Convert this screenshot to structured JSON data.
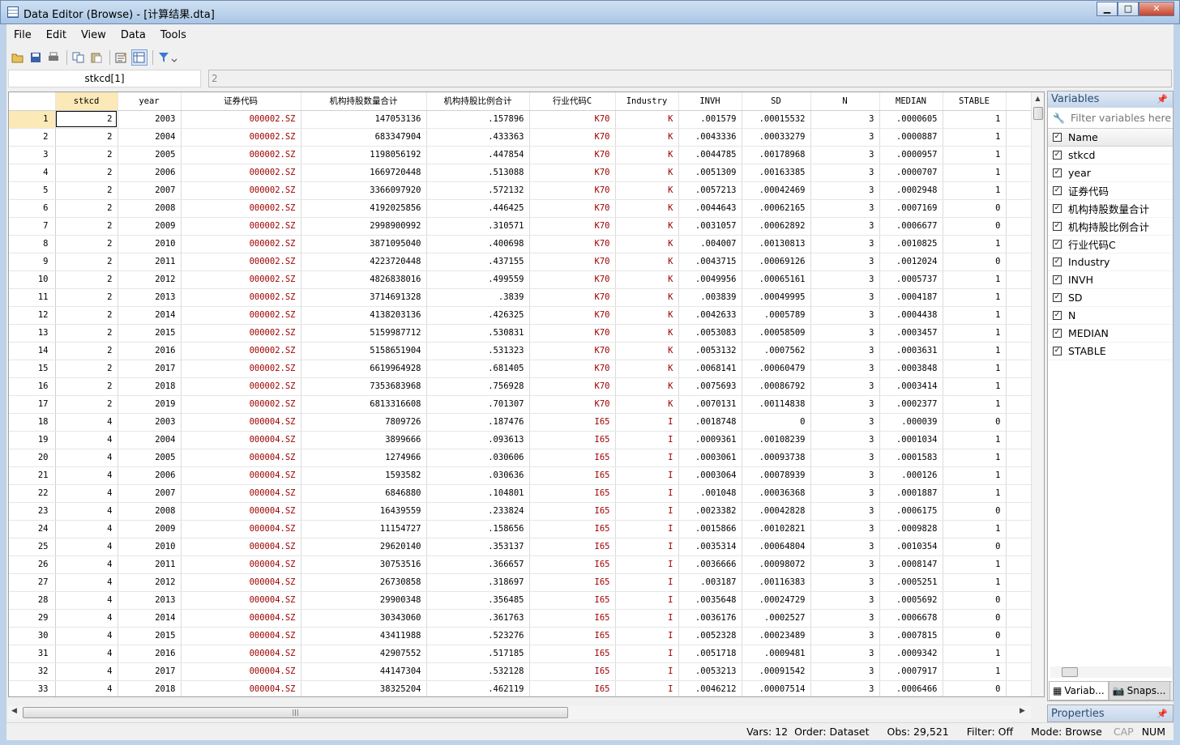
{
  "window": {
    "title": "Data Editor (Browse) - [计算结果.dta]",
    "minimize": "▁",
    "maximize": "□",
    "close": "✕"
  },
  "menu": [
    "File",
    "Edit",
    "View",
    "Data",
    "Tools"
  ],
  "toolbar_icons": [
    "open-icon",
    "save-icon",
    "print-icon",
    "copy-icon",
    "paste-icon",
    "variables-manager-icon",
    "properties-icon",
    "filter-icon"
  ],
  "cell_ref": "stkcd[1]",
  "cell_value": "2",
  "columns": [
    "stkcd",
    "year",
    "证券代码",
    "机构持股数量合计",
    "机构持股比例合计",
    "行业代码C",
    "Industry",
    "INVH",
    "SD",
    "N",
    "MEDIAN",
    "STABLE"
  ],
  "rows": [
    [
      "1",
      "2",
      "2003",
      "000002.SZ",
      "147053136",
      ".157896",
      "K70",
      "K",
      ".001579",
      ".00015532",
      "3",
      ".0000605",
      "1"
    ],
    [
      "2",
      "2",
      "2004",
      "000002.SZ",
      "683347904",
      ".433363",
      "K70",
      "K",
      ".0043336",
      ".00033279",
      "3",
      ".0000887",
      "1"
    ],
    [
      "3",
      "2",
      "2005",
      "000002.SZ",
      "1198056192",
      ".447854",
      "K70",
      "K",
      ".0044785",
      ".00178968",
      "3",
      ".0000957",
      "1"
    ],
    [
      "4",
      "2",
      "2006",
      "000002.SZ",
      "1669720448",
      ".513088",
      "K70",
      "K",
      ".0051309",
      ".00163385",
      "3",
      ".0000707",
      "1"
    ],
    [
      "5",
      "2",
      "2007",
      "000002.SZ",
      "3366097920",
      ".572132",
      "K70",
      "K",
      ".0057213",
      ".00042469",
      "3",
      ".0002948",
      "1"
    ],
    [
      "6",
      "2",
      "2008",
      "000002.SZ",
      "4192025856",
      ".446425",
      "K70",
      "K",
      ".0044643",
      ".00062165",
      "3",
      ".0007169",
      "0"
    ],
    [
      "7",
      "2",
      "2009",
      "000002.SZ",
      "2998900992",
      ".310571",
      "K70",
      "K",
      ".0031057",
      ".00062892",
      "3",
      ".0006677",
      "0"
    ],
    [
      "8",
      "2",
      "2010",
      "000002.SZ",
      "3871095040",
      ".400698",
      "K70",
      "K",
      ".004007",
      ".00130813",
      "3",
      ".0010825",
      "1"
    ],
    [
      "9",
      "2",
      "2011",
      "000002.SZ",
      "4223720448",
      ".437155",
      "K70",
      "K",
      ".0043715",
      ".00069126",
      "3",
      ".0012024",
      "0"
    ],
    [
      "10",
      "2",
      "2012",
      "000002.SZ",
      "4826838016",
      ".499559",
      "K70",
      "K",
      ".0049956",
      ".00065161",
      "3",
      ".0005737",
      "1"
    ],
    [
      "11",
      "2",
      "2013",
      "000002.SZ",
      "3714691328",
      ".3839",
      "K70",
      "K",
      ".003839",
      ".00049995",
      "3",
      ".0004187",
      "1"
    ],
    [
      "12",
      "2",
      "2014",
      "000002.SZ",
      "4138203136",
      ".426325",
      "K70",
      "K",
      ".0042633",
      ".0005789",
      "3",
      ".0004438",
      "1"
    ],
    [
      "13",
      "2",
      "2015",
      "000002.SZ",
      "5159987712",
      ".530831",
      "K70",
      "K",
      ".0053083",
      ".00058509",
      "3",
      ".0003457",
      "1"
    ],
    [
      "14",
      "2",
      "2016",
      "000002.SZ",
      "5158651904",
      ".531323",
      "K70",
      "K",
      ".0053132",
      ".0007562",
      "3",
      ".0003631",
      "1"
    ],
    [
      "15",
      "2",
      "2017",
      "000002.SZ",
      "6619964928",
      ".681405",
      "K70",
      "K",
      ".0068141",
      ".00060479",
      "3",
      ".0003848",
      "1"
    ],
    [
      "16",
      "2",
      "2018",
      "000002.SZ",
      "7353683968",
      ".756928",
      "K70",
      "K",
      ".0075693",
      ".00086792",
      "3",
      ".0003414",
      "1"
    ],
    [
      "17",
      "2",
      "2019",
      "000002.SZ",
      "6813316608",
      ".701307",
      "K70",
      "K",
      ".0070131",
      ".00114838",
      "3",
      ".0002377",
      "1"
    ],
    [
      "18",
      "4",
      "2003",
      "000004.SZ",
      "7809726",
      ".187476",
      "I65",
      "I",
      ".0018748",
      "0",
      "3",
      ".000039",
      "0"
    ],
    [
      "19",
      "4",
      "2004",
      "000004.SZ",
      "3899666",
      ".093613",
      "I65",
      "I",
      ".0009361",
      ".00108239",
      "3",
      ".0001034",
      "1"
    ],
    [
      "20",
      "4",
      "2005",
      "000004.SZ",
      "1274966",
      ".030606",
      "I65",
      "I",
      ".0003061",
      ".00093738",
      "3",
      ".0001583",
      "1"
    ],
    [
      "21",
      "4",
      "2006",
      "000004.SZ",
      "1593582",
      ".030636",
      "I65",
      "I",
      ".0003064",
      ".00078939",
      "3",
      ".000126",
      "1"
    ],
    [
      "22",
      "4",
      "2007",
      "000004.SZ",
      "6846880",
      ".104801",
      "I65",
      "I",
      ".001048",
      ".00036368",
      "3",
      ".0001887",
      "1"
    ],
    [
      "23",
      "4",
      "2008",
      "000004.SZ",
      "16439559",
      ".233824",
      "I65",
      "I",
      ".0023382",
      ".00042828",
      "3",
      ".0006175",
      "0"
    ],
    [
      "24",
      "4",
      "2009",
      "000004.SZ",
      "11154727",
      ".158656",
      "I65",
      "I",
      ".0015866",
      ".00102821",
      "3",
      ".0009828",
      "1"
    ],
    [
      "25",
      "4",
      "2010",
      "000004.SZ",
      "29620140",
      ".353137",
      "I65",
      "I",
      ".0035314",
      ".00064804",
      "3",
      ".0010354",
      "0"
    ],
    [
      "26",
      "4",
      "2011",
      "000004.SZ",
      "30753516",
      ".366657",
      "I65",
      "I",
      ".0036666",
      ".00098072",
      "3",
      ".0008147",
      "1"
    ],
    [
      "27",
      "4",
      "2012",
      "000004.SZ",
      "26730858",
      ".318697",
      "I65",
      "I",
      ".003187",
      ".00116383",
      "3",
      ".0005251",
      "1"
    ],
    [
      "28",
      "4",
      "2013",
      "000004.SZ",
      "29900348",
      ".356485",
      "I65",
      "I",
      ".0035648",
      ".00024729",
      "3",
      ".0005692",
      "0"
    ],
    [
      "29",
      "4",
      "2014",
      "000004.SZ",
      "30343060",
      ".361763",
      "I65",
      "I",
      ".0036176",
      ".0002527",
      "3",
      ".0006678",
      "0"
    ],
    [
      "30",
      "4",
      "2015",
      "000004.SZ",
      "43411988",
      ".523276",
      "I65",
      "I",
      ".0052328",
      ".00023489",
      "3",
      ".0007815",
      "0"
    ],
    [
      "31",
      "4",
      "2016",
      "000004.SZ",
      "42907552",
      ".517185",
      "I65",
      "I",
      ".0051718",
      ".0009481",
      "3",
      ".0009342",
      "1"
    ],
    [
      "32",
      "4",
      "2017",
      "000004.SZ",
      "44147304",
      ".532128",
      "I65",
      "I",
      ".0053213",
      ".00091542",
      "3",
      ".0007917",
      "1"
    ],
    [
      "33",
      "4",
      "2018",
      "000004.SZ",
      "38325204",
      ".462119",
      "I65",
      "I",
      ".0046212",
      ".00007514",
      "3",
      ".0006466",
      "0"
    ]
  ],
  "variables_panel": {
    "title": "Variables",
    "filter_placeholder": "Filter variables here",
    "name_header": "Name",
    "items": [
      "stkcd",
      "year",
      "证券代码",
      "机构持股数量合计",
      "机构持股比例合计",
      "行业代码C",
      "Industry",
      "INVH",
      "SD",
      "N",
      "MEDIAN",
      "STABLE"
    ],
    "tab_variables": "Variab...",
    "tab_snapshots": "Snaps..."
  },
  "properties_panel": {
    "title": "Properties"
  },
  "status": {
    "vars": "Vars: 12",
    "order": "Order: Dataset",
    "obs": "Obs: 29,521",
    "filter": "Filter: Off",
    "mode": "Mode: Browse",
    "cap": "CAP",
    "num": "NUM"
  }
}
